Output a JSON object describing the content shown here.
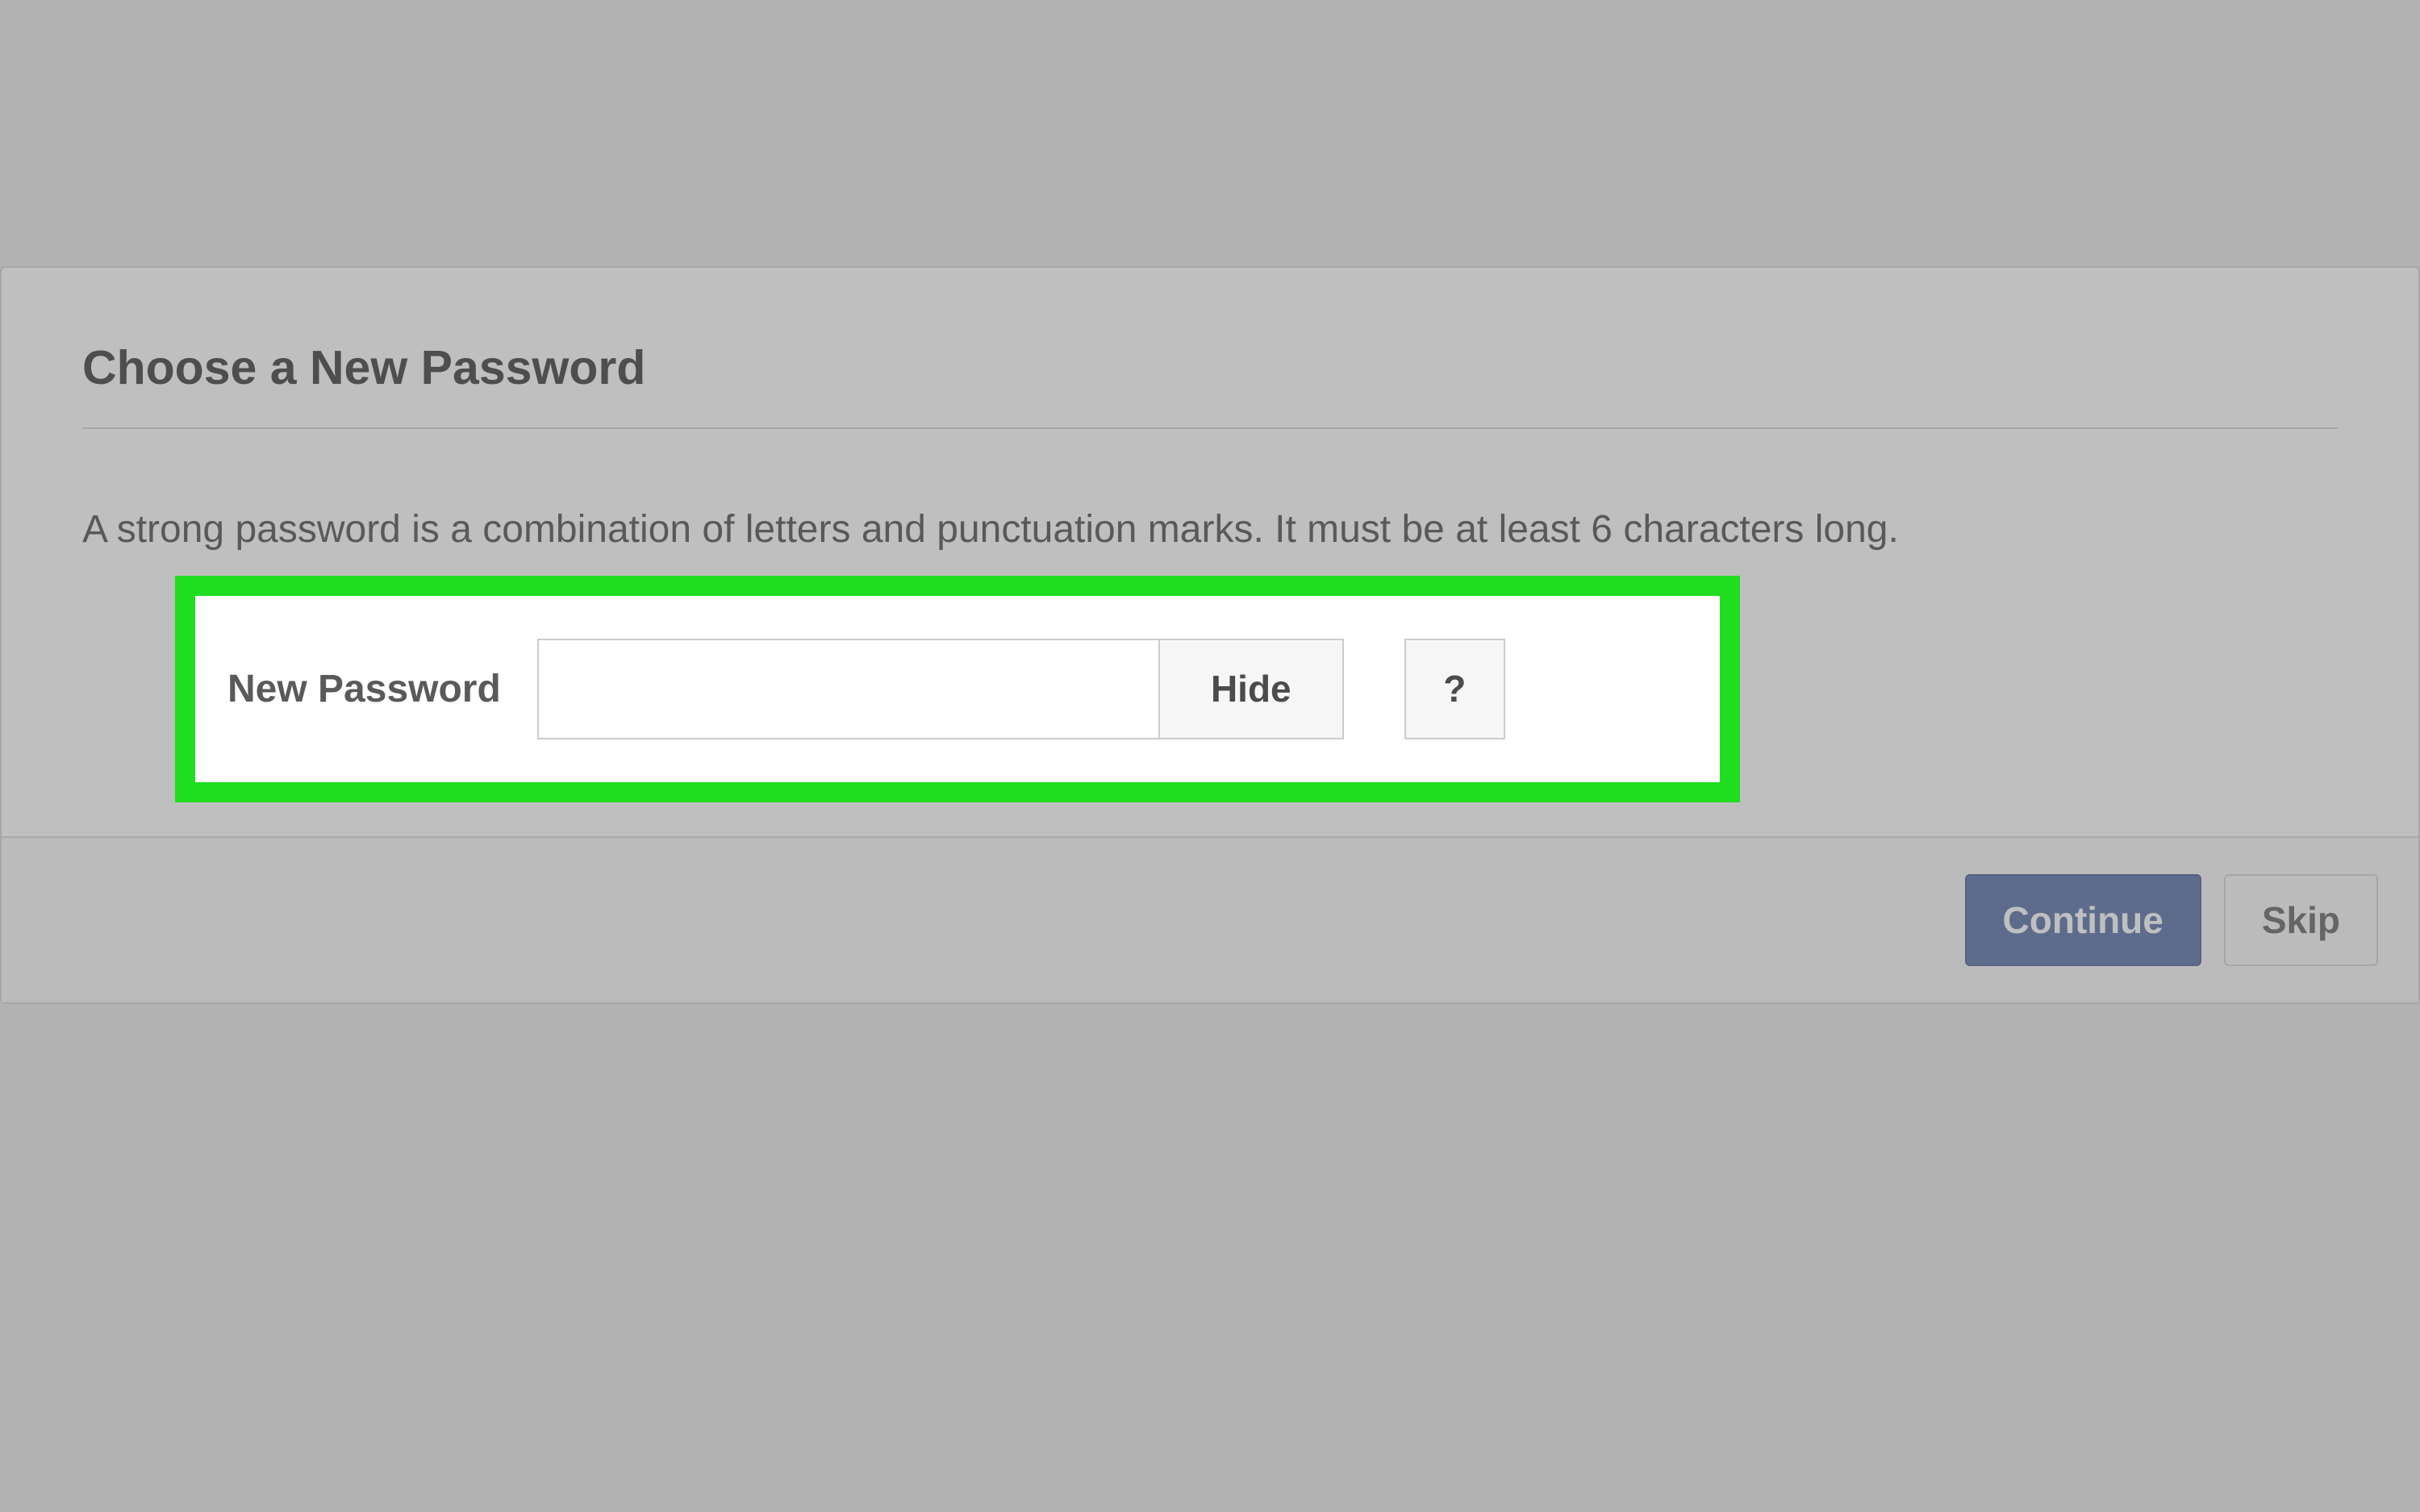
{
  "dialog": {
    "title": "Choose a New Password",
    "description": "A strong password is a combination of letters and punctuation marks. It must be at least 6 characters long.",
    "password_label": "New Password",
    "password_value": "",
    "hide_button_label": "Hide",
    "help_button_label": "?",
    "continue_button_label": "Continue",
    "skip_button_label": "Skip"
  },
  "colors": {
    "highlight_border": "#1fdd1f",
    "primary_button": "#3b5998"
  }
}
